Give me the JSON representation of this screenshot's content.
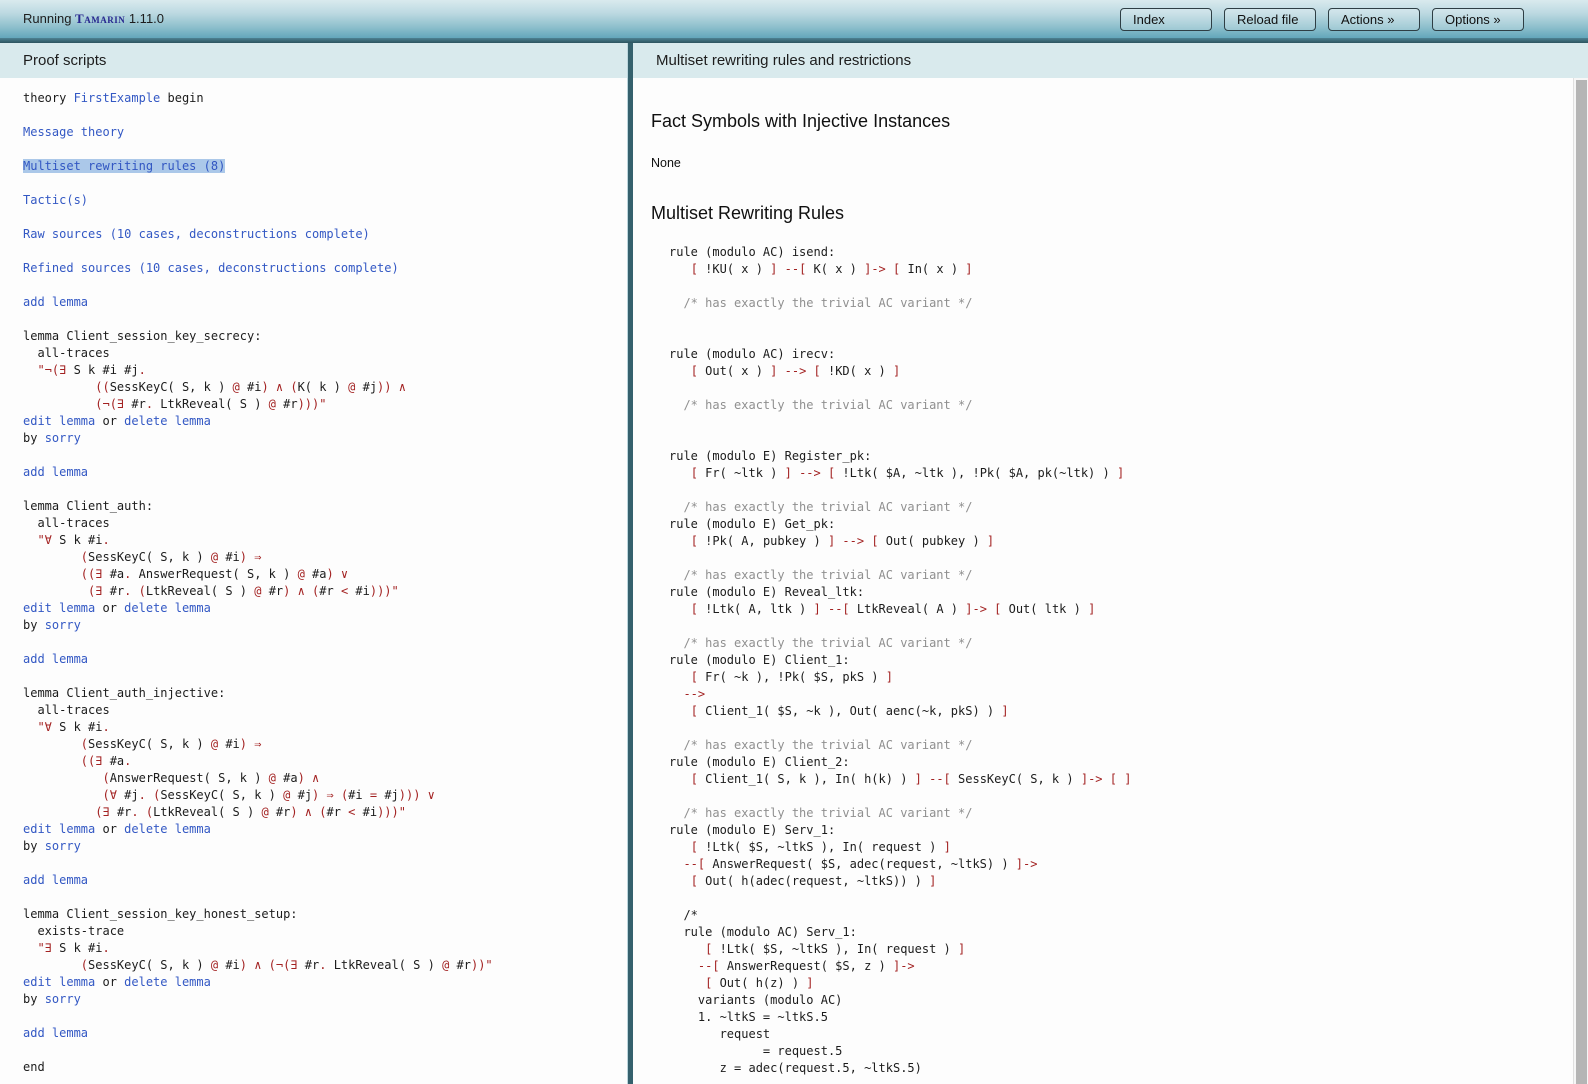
{
  "toolbar": {
    "running_prefix": "Running ",
    "app_name": "Tamarin",
    "version": " 1.11.0",
    "buttons": [
      {
        "label": "Index"
      },
      {
        "label": "Reload file"
      },
      {
        "label": "Actions »"
      },
      {
        "label": "Options »"
      }
    ]
  },
  "left_panel": {
    "header": "Proof scripts",
    "lines": [
      [
        [
          "k",
          "theory "
        ],
        [
          "b",
          "FirstExample"
        ],
        [
          "k",
          " begin"
        ]
      ],
      [],
      [
        [
          "b",
          "Message theory"
        ]
      ],
      [],
      [
        [
          "hl",
          "Multiset rewriting rules (8)"
        ]
      ],
      [],
      [
        [
          "b",
          "Tactic(s)"
        ]
      ],
      [],
      [
        [
          "b",
          "Raw sources (10 cases, deconstructions complete)"
        ]
      ],
      [],
      [
        [
          "b",
          "Refined sources (10 cases, deconstructions complete)"
        ]
      ],
      [],
      [
        [
          "b",
          "add lemma"
        ]
      ],
      [],
      [
        [
          "k",
          "lemma Client_session_key_secrecy:"
        ]
      ],
      [
        [
          "k",
          "  all-traces"
        ]
      ],
      [
        [
          "k",
          "  "
        ],
        [
          "r",
          "\"¬(∃ "
        ],
        [
          "k",
          "S k #i #j"
        ],
        [
          "r",
          "."
        ]
      ],
      [
        [
          "k",
          "          "
        ],
        [
          "r",
          "(("
        ],
        [
          "k",
          "SessKeyC( S, k ) "
        ],
        [
          "r",
          "@ "
        ],
        [
          "k",
          "#i"
        ],
        [
          "r",
          ") ∧ ("
        ],
        [
          "k",
          "K( k ) "
        ],
        [
          "r",
          "@ "
        ],
        [
          "k",
          "#j"
        ],
        [
          "r",
          ")) ∧"
        ]
      ],
      [
        [
          "k",
          "          "
        ],
        [
          "r",
          "(¬(∃ "
        ],
        [
          "k",
          "#r"
        ],
        [
          "r",
          ". "
        ],
        [
          "k",
          "LtkReveal( S ) "
        ],
        [
          "r",
          "@ "
        ],
        [
          "k",
          "#r"
        ],
        [
          "r",
          ")))\""
        ]
      ],
      [
        [
          "b",
          "edit lemma"
        ],
        [
          "k",
          " or "
        ],
        [
          "b",
          "delete lemma"
        ]
      ],
      [
        [
          "k",
          "by "
        ],
        [
          "b",
          "sorry"
        ]
      ],
      [],
      [
        [
          "b",
          "add lemma"
        ]
      ],
      [],
      [
        [
          "k",
          "lemma Client_auth:"
        ]
      ],
      [
        [
          "k",
          "  all-traces"
        ]
      ],
      [
        [
          "k",
          "  "
        ],
        [
          "r",
          "\"∀ "
        ],
        [
          "k",
          "S k #i"
        ],
        [
          "r",
          "."
        ]
      ],
      [
        [
          "k",
          "        "
        ],
        [
          "r",
          "("
        ],
        [
          "k",
          "SessKeyC( S, k ) "
        ],
        [
          "r",
          "@ "
        ],
        [
          "k",
          "#i"
        ],
        [
          "r",
          ") ⇒"
        ]
      ],
      [
        [
          "k",
          "        "
        ],
        [
          "r",
          "((∃ "
        ],
        [
          "k",
          "#a"
        ],
        [
          "r",
          ". "
        ],
        [
          "k",
          "AnswerRequest( S, k ) "
        ],
        [
          "r",
          "@ "
        ],
        [
          "k",
          "#a"
        ],
        [
          "r",
          ") ∨"
        ]
      ],
      [
        [
          "k",
          "         "
        ],
        [
          "r",
          "(∃ "
        ],
        [
          "k",
          "#r"
        ],
        [
          "r",
          ". ("
        ],
        [
          "k",
          "LtkReveal( S ) "
        ],
        [
          "r",
          "@ "
        ],
        [
          "k",
          "#r"
        ],
        [
          "r",
          ") ∧ ("
        ],
        [
          "k",
          "#r "
        ],
        [
          "r",
          "< "
        ],
        [
          "k",
          "#i"
        ],
        [
          "r",
          ")))\""
        ]
      ],
      [
        [
          "b",
          "edit lemma"
        ],
        [
          "k",
          " or "
        ],
        [
          "b",
          "delete lemma"
        ]
      ],
      [
        [
          "k",
          "by "
        ],
        [
          "b",
          "sorry"
        ]
      ],
      [],
      [
        [
          "b",
          "add lemma"
        ]
      ],
      [],
      [
        [
          "k",
          "lemma Client_auth_injective:"
        ]
      ],
      [
        [
          "k",
          "  all-traces"
        ]
      ],
      [
        [
          "k",
          "  "
        ],
        [
          "r",
          "\"∀ "
        ],
        [
          "k",
          "S k #i"
        ],
        [
          "r",
          "."
        ]
      ],
      [
        [
          "k",
          "        "
        ],
        [
          "r",
          "("
        ],
        [
          "k",
          "SessKeyC( S, k ) "
        ],
        [
          "r",
          "@ "
        ],
        [
          "k",
          "#i"
        ],
        [
          "r",
          ") ⇒"
        ]
      ],
      [
        [
          "k",
          "        "
        ],
        [
          "r",
          "((∃ "
        ],
        [
          "k",
          "#a"
        ],
        [
          "r",
          "."
        ]
      ],
      [
        [
          "k",
          "           "
        ],
        [
          "r",
          "("
        ],
        [
          "k",
          "AnswerRequest( S, k ) "
        ],
        [
          "r",
          "@ "
        ],
        [
          "k",
          "#a"
        ],
        [
          "r",
          ") ∧"
        ]
      ],
      [
        [
          "k",
          "           "
        ],
        [
          "r",
          "(∀ "
        ],
        [
          "k",
          "#j"
        ],
        [
          "r",
          ". ("
        ],
        [
          "k",
          "SessKeyC( S, k ) "
        ],
        [
          "r",
          "@ "
        ],
        [
          "k",
          "#j"
        ],
        [
          "r",
          ") ⇒ ("
        ],
        [
          "k",
          "#i "
        ],
        [
          "r",
          "= "
        ],
        [
          "k",
          "#j"
        ],
        [
          "r",
          "))) ∨"
        ]
      ],
      [
        [
          "k",
          "          "
        ],
        [
          "r",
          "(∃ "
        ],
        [
          "k",
          "#r"
        ],
        [
          "r",
          ". ("
        ],
        [
          "k",
          "LtkReveal( S ) "
        ],
        [
          "r",
          "@ "
        ],
        [
          "k",
          "#r"
        ],
        [
          "r",
          ") ∧ ("
        ],
        [
          "k",
          "#r "
        ],
        [
          "r",
          "< "
        ],
        [
          "k",
          "#i"
        ],
        [
          "r",
          ")))\""
        ]
      ],
      [
        [
          "b",
          "edit lemma"
        ],
        [
          "k",
          " or "
        ],
        [
          "b",
          "delete lemma"
        ]
      ],
      [
        [
          "k",
          "by "
        ],
        [
          "b",
          "sorry"
        ]
      ],
      [],
      [
        [
          "b",
          "add lemma"
        ]
      ],
      [],
      [
        [
          "k",
          "lemma Client_session_key_honest_setup:"
        ]
      ],
      [
        [
          "k",
          "  exists-trace"
        ]
      ],
      [
        [
          "k",
          "  "
        ],
        [
          "r",
          "\"∃ "
        ],
        [
          "k",
          "S k #i"
        ],
        [
          "r",
          "."
        ]
      ],
      [
        [
          "k",
          "        "
        ],
        [
          "r",
          "("
        ],
        [
          "k",
          "SessKeyC( S, k ) "
        ],
        [
          "r",
          "@ "
        ],
        [
          "k",
          "#i"
        ],
        [
          "r",
          ") ∧ (¬(∃ "
        ],
        [
          "k",
          "#r"
        ],
        [
          "r",
          ". "
        ],
        [
          "k",
          "LtkReveal( S ) "
        ],
        [
          "r",
          "@ "
        ],
        [
          "k",
          "#r"
        ],
        [
          "r",
          "))\""
        ]
      ],
      [
        [
          "b",
          "edit lemma"
        ],
        [
          "k",
          " or "
        ],
        [
          "b",
          "delete lemma"
        ]
      ],
      [
        [
          "k",
          "by "
        ],
        [
          "b",
          "sorry"
        ]
      ],
      [],
      [
        [
          "b",
          "add lemma"
        ]
      ],
      [],
      [
        [
          "k",
          "end"
        ]
      ]
    ]
  },
  "right_panel": {
    "header": "Multiset rewriting rules and restrictions",
    "fact_symbols_heading": "Fact Symbols with Injective Instances",
    "fact_symbols_value": "None",
    "rules_heading": "Multiset Rewriting Rules",
    "lines": [
      [
        [
          "k",
          "rule (modulo AC) isend:"
        ]
      ],
      [
        [
          "k",
          "   "
        ],
        [
          "r",
          "[ "
        ],
        [
          "k",
          "!KU( x ) "
        ],
        [
          "r",
          "] --[ "
        ],
        [
          "k",
          "K( x ) "
        ],
        [
          "r",
          "]-> [ "
        ],
        [
          "k",
          "In( x ) "
        ],
        [
          "r",
          "]"
        ]
      ],
      [],
      [
        [
          "g",
          "  /* has exactly the trivial AC variant */"
        ]
      ],
      [],
      [],
      [
        [
          "k",
          "rule (modulo AC) irecv:"
        ]
      ],
      [
        [
          "k",
          "   "
        ],
        [
          "r",
          "[ "
        ],
        [
          "k",
          "Out( x ) "
        ],
        [
          "r",
          "] --> [ "
        ],
        [
          "k",
          "!KD( x ) "
        ],
        [
          "r",
          "]"
        ]
      ],
      [],
      [
        [
          "g",
          "  /* has exactly the trivial AC variant */"
        ]
      ],
      [],
      [],
      [
        [
          "k",
          "rule (modulo E) Register_pk:"
        ]
      ],
      [
        [
          "k",
          "   "
        ],
        [
          "r",
          "[ "
        ],
        [
          "k",
          "Fr( ~ltk ) "
        ],
        [
          "r",
          "] --> [ "
        ],
        [
          "k",
          "!Ltk( $A, ~ltk ), !Pk( $A, pk(~ltk) ) "
        ],
        [
          "r",
          "]"
        ]
      ],
      [],
      [
        [
          "g",
          "  /* has exactly the trivial AC variant */"
        ]
      ],
      [
        [
          "k",
          "rule (modulo E) Get_pk:"
        ]
      ],
      [
        [
          "k",
          "   "
        ],
        [
          "r",
          "[ "
        ],
        [
          "k",
          "!Pk( A, pubkey ) "
        ],
        [
          "r",
          "] --> [ "
        ],
        [
          "k",
          "Out( pubkey ) "
        ],
        [
          "r",
          "]"
        ]
      ],
      [],
      [
        [
          "g",
          "  /* has exactly the trivial AC variant */"
        ]
      ],
      [
        [
          "k",
          "rule (modulo E) Reveal_ltk:"
        ]
      ],
      [
        [
          "k",
          "   "
        ],
        [
          "r",
          "[ "
        ],
        [
          "k",
          "!Ltk( A, ltk ) "
        ],
        [
          "r",
          "] --[ "
        ],
        [
          "k",
          "LtkReveal( A ) "
        ],
        [
          "r",
          "]-> [ "
        ],
        [
          "k",
          "Out( ltk ) "
        ],
        [
          "r",
          "]"
        ]
      ],
      [],
      [
        [
          "g",
          "  /* has exactly the trivial AC variant */"
        ]
      ],
      [
        [
          "k",
          "rule (modulo E) Client_1:"
        ]
      ],
      [
        [
          "k",
          "   "
        ],
        [
          "r",
          "[ "
        ],
        [
          "k",
          "Fr( ~k ), !Pk( $S, pkS ) "
        ],
        [
          "r",
          "]"
        ]
      ],
      [
        [
          "k",
          "  "
        ],
        [
          "r",
          "-->"
        ]
      ],
      [
        [
          "k",
          "   "
        ],
        [
          "r",
          "[ "
        ],
        [
          "k",
          "Client_1( $S, ~k ), Out( aenc(~k, pkS) ) "
        ],
        [
          "r",
          "]"
        ]
      ],
      [],
      [
        [
          "g",
          "  /* has exactly the trivial AC variant */"
        ]
      ],
      [
        [
          "k",
          "rule (modulo E) Client_2:"
        ]
      ],
      [
        [
          "k",
          "   "
        ],
        [
          "r",
          "[ "
        ],
        [
          "k",
          "Client_1( S, k ), In( h(k) ) "
        ],
        [
          "r",
          "] --[ "
        ],
        [
          "k",
          "SessKeyC( S, k ) "
        ],
        [
          "r",
          "]-> [ ]"
        ]
      ],
      [],
      [
        [
          "g",
          "  /* has exactly the trivial AC variant */"
        ]
      ],
      [
        [
          "k",
          "rule (modulo E) Serv_1:"
        ]
      ],
      [
        [
          "k",
          "   "
        ],
        [
          "r",
          "[ "
        ],
        [
          "k",
          "!Ltk( $S, ~ltkS ), In( request ) "
        ],
        [
          "r",
          "]"
        ]
      ],
      [
        [
          "k",
          "  "
        ],
        [
          "r",
          "--[ "
        ],
        [
          "k",
          "AnswerRequest( $S, adec(request, ~ltkS) ) "
        ],
        [
          "r",
          "]->"
        ]
      ],
      [
        [
          "k",
          "   "
        ],
        [
          "r",
          "[ "
        ],
        [
          "k",
          "Out( h(adec(request, ~ltkS)) ) "
        ],
        [
          "r",
          "]"
        ]
      ],
      [],
      [
        [
          "k",
          "  /*"
        ]
      ],
      [
        [
          "k",
          "  rule (modulo AC) Serv_1:"
        ]
      ],
      [
        [
          "k",
          "     "
        ],
        [
          "r",
          "[ "
        ],
        [
          "k",
          "!Ltk( $S, ~ltkS ), In( request ) "
        ],
        [
          "r",
          "]"
        ]
      ],
      [
        [
          "k",
          "    "
        ],
        [
          "r",
          "--[ "
        ],
        [
          "k",
          "AnswerRequest( $S, z ) "
        ],
        [
          "r",
          "]->"
        ]
      ],
      [
        [
          "k",
          "     "
        ],
        [
          "r",
          "[ "
        ],
        [
          "k",
          "Out( h(z) ) "
        ],
        [
          "r",
          "]"
        ]
      ],
      [
        [
          "k",
          "    variants (modulo AC)"
        ]
      ],
      [
        [
          "k",
          "    1. ~ltkS = ~ltkS.5"
        ]
      ],
      [
        [
          "k",
          "       request"
        ]
      ],
      [
        [
          "k",
          "             = request.5"
        ]
      ],
      [
        [
          "k",
          "       z = adec(request.5, ~ltkS.5)"
        ]
      ]
    ]
  },
  "colors": {
    "link_blue": "#3358c4",
    "operator_red": "#a32222",
    "comment_gray": "#8f8f8f",
    "highlight_bg": "#abc8e9",
    "panel_header_bg": "#d9eaed",
    "divider_teal": "#35616d",
    "logo_blue": "#27278f"
  }
}
